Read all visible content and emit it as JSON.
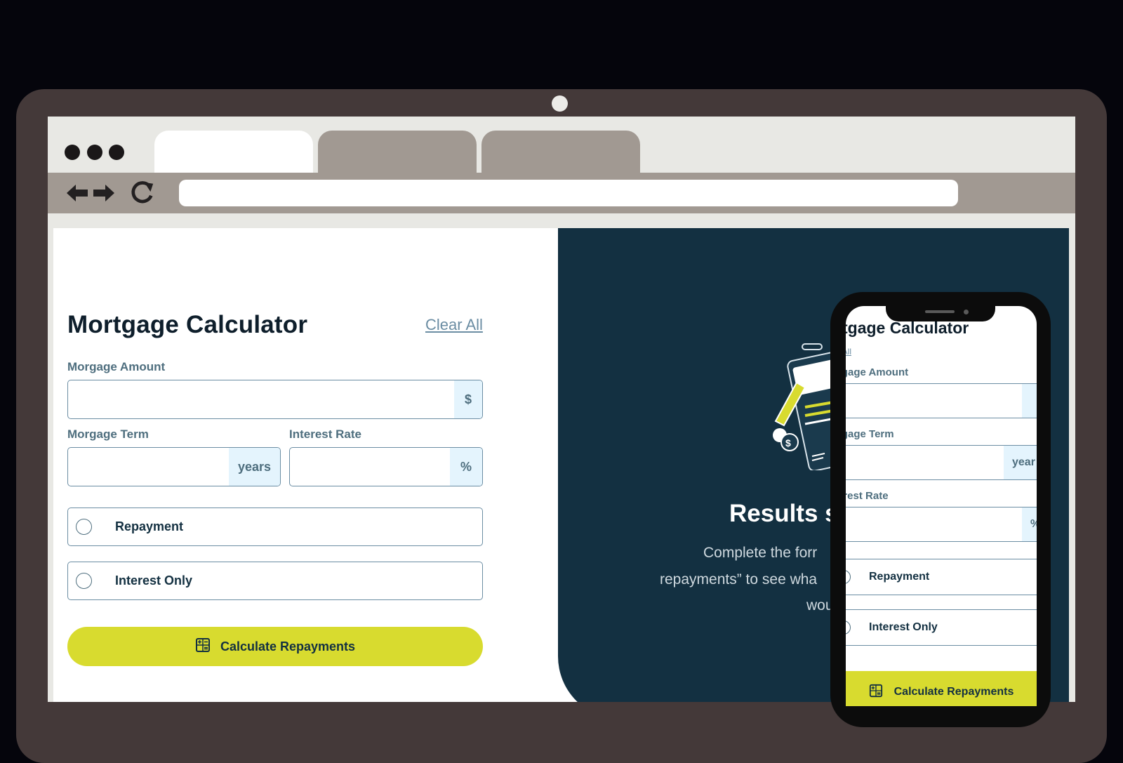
{
  "desktop": {
    "title": "Mortgage Calculator",
    "clear_all": "Clear All",
    "mortgage_amount": {
      "label": "Morgage Amount",
      "value": "",
      "suffix": "$"
    },
    "mortgage_term": {
      "label": "Morgage Term",
      "value": "",
      "suffix": "years"
    },
    "interest_rate": {
      "label": "Interest Rate",
      "value": "",
      "suffix": "%"
    },
    "mortgage_types": [
      {
        "label": "Repayment",
        "selected": false
      },
      {
        "label": "Interest Only",
        "selected": false
      }
    ],
    "calculate_button": "Calculate Repayments",
    "results": {
      "title": "Results s",
      "desc_line1": "Complete the forr",
      "desc_line2": "repayments” to see wha",
      "desc_line3": "wou"
    }
  },
  "mobile": {
    "title": "ortgage Calculator",
    "clear_all": "r All",
    "mortgage_amount_label": "rgage Amount",
    "mortgage_term_label": "rgage Term",
    "term_suffix": "year",
    "interest_rate_label": "erest Rate",
    "rate_suffix": "%",
    "repayment": "Repayment",
    "interest_only": "Interest Only",
    "calculate_button": "Calculate Repayments"
  },
  "colors": {
    "navy": "#133041",
    "lime": "#d8db2f",
    "slate": "#6b8da3",
    "suffix_bg": "#e4f4fd"
  },
  "icons": [
    "back-arrow-icon",
    "forward-arrow-icon",
    "reload-icon",
    "calculator-icon",
    "results-illustration-icon"
  ]
}
